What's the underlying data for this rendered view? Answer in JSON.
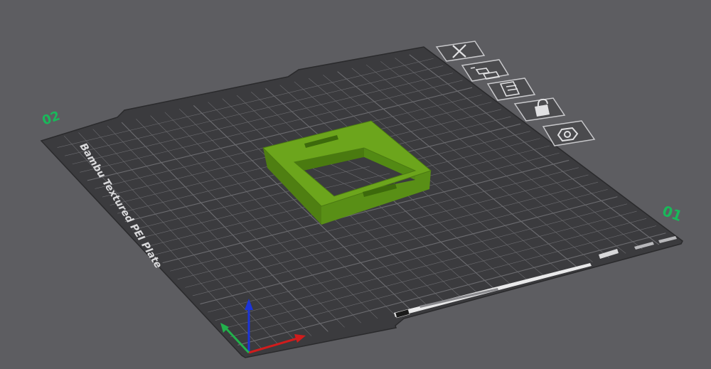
{
  "plate": {
    "label": "Bambu Textured PEI Plate",
    "number_left": "02",
    "number_right": "01",
    "color": "#3b3b3e",
    "grid_color": "#6c6c70",
    "number_color": "#19b85a"
  },
  "toolbar": {
    "items": [
      {
        "name": "close-plate-button",
        "icon": "close-icon"
      },
      {
        "name": "arrange-button",
        "icon": "arrange-icon"
      },
      {
        "name": "plate-settings-button",
        "icon": "plate-settings-icon"
      },
      {
        "name": "lock-plate-button",
        "icon": "lock-icon"
      },
      {
        "name": "plate-options-button",
        "icon": "gear-icon"
      }
    ]
  },
  "model": {
    "name": "square-frame-part",
    "color": "#6ca51c"
  },
  "axes": {
    "x_color": "#d01c1c",
    "y_color": "#22b14c",
    "z_color": "#1c34d8"
  }
}
